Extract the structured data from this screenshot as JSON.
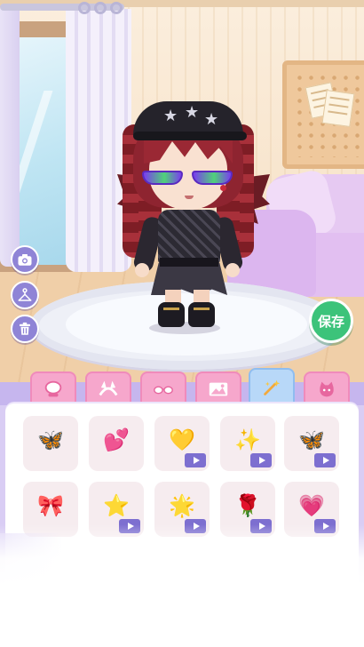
{
  "scene": {
    "name": "bedroom-background"
  },
  "side_buttons": [
    {
      "icon": "camera-icon"
    },
    {
      "icon": "hanger-icon"
    },
    {
      "icon": "trash-icon"
    }
  ],
  "save_button": {
    "label": "保存",
    "color": "#3cc37a"
  },
  "tabs": [
    {
      "icon": "mirror-icon",
      "active": false
    },
    {
      "icon": "headband-icon",
      "active": false
    },
    {
      "icon": "glasses-icon",
      "active": false
    },
    {
      "icon": "background-image-icon",
      "active": false
    },
    {
      "icon": "magic-wand-icon",
      "active": true
    },
    {
      "icon": "pet-cat-icon",
      "active": false
    }
  ],
  "items": [
    {
      "icon": "butterflies-icon",
      "symbol": "🦋",
      "video": false
    },
    {
      "icon": "hearts-icon",
      "symbol": "💕",
      "video": false
    },
    {
      "icon": "pastel-hearts-icon",
      "symbol": "💛",
      "video": true
    },
    {
      "icon": "sparkle-stars-icon",
      "symbol": "✨",
      "video": true
    },
    {
      "icon": "blue-butterflies-icon",
      "symbol": "🦋",
      "video": true
    },
    {
      "icon": "music-bow-icon",
      "symbol": "🎀",
      "video": false
    },
    {
      "icon": "rainbow-stars-icon",
      "symbol": "⭐",
      "video": true
    },
    {
      "icon": "colorful-stars-icon",
      "symbol": "🌟",
      "video": true
    },
    {
      "icon": "red-rose-icon",
      "symbol": "🌹",
      "video": true
    },
    {
      "icon": "heart-bubbles-icon",
      "symbol": "💗",
      "video": true
    }
  ],
  "colors": {
    "accent": "#8f84d6",
    "tab": "#f6a7cc",
    "tab_active": "#b8d8f8",
    "panel": "#d9cdf4"
  }
}
